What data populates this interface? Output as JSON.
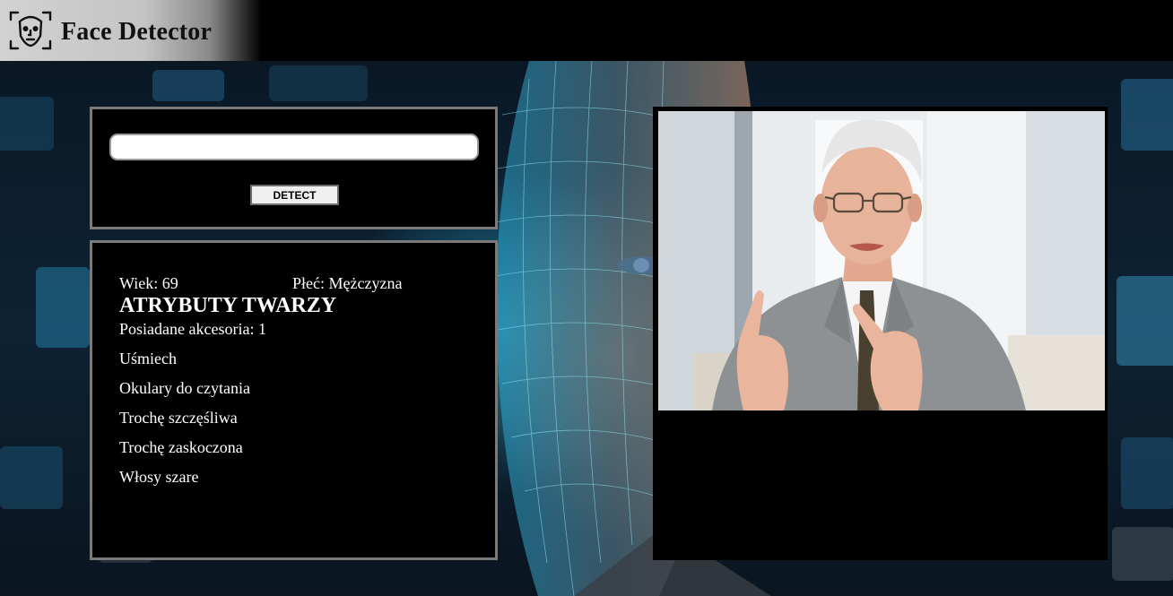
{
  "header": {
    "title": "Face Detector",
    "logo_icon": "face-scan-icon"
  },
  "detect_form": {
    "url_value": "",
    "button_label": "DETECT"
  },
  "results": {
    "age_label": "Wiek:",
    "age_value": "69",
    "gender_label": "Płeć:",
    "gender_value": "Mężczyzna",
    "heading": "ATRYBUTY TWARZY",
    "accessories_label": "Posiadane akcesoria:",
    "accessories_count": "1",
    "attributes": [
      "Uśmiech",
      "Okulary do czytania",
      "Trochę szczęśliwa",
      "Trochę zaskoczona",
      "Włosy szare"
    ]
  },
  "preview": {
    "photo": "elderly-man-with-glasses-gesturing"
  },
  "colors": {
    "panel_border": "#7a7a7a",
    "panel_bg": "#000000",
    "header_bg": "#000000",
    "brand_bg": "#cfcfcf",
    "result_text": "#ffffff"
  }
}
